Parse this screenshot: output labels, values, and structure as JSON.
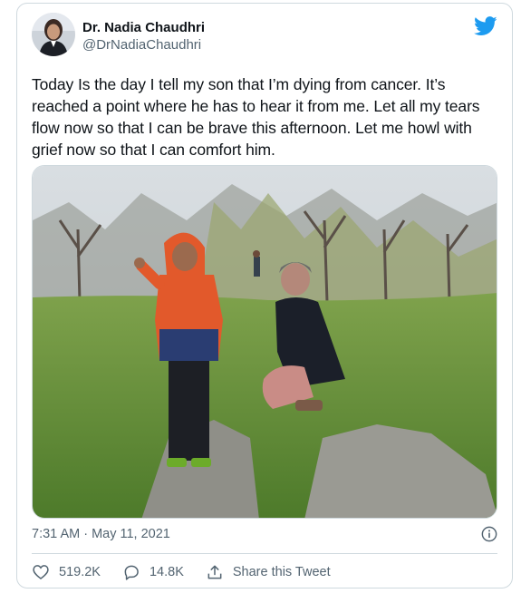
{
  "user": {
    "display_name": "Dr. Nadia Chaudhri",
    "handle": "@DrNadiaChaudhri"
  },
  "tweet": {
    "text": "Today Is the day I tell my son that I’m dying from cancer. It’s reached a point where he has to hear it from me. Let all my tears flow now so that I can be brave this afternoon. Let me howl with grief now so that I can comfort him.",
    "timestamp": "7:31 AM · May 11, 2021"
  },
  "actions": {
    "likes": "519.2K",
    "replies": "14.8K",
    "share_label": "Share this Tweet"
  },
  "icons": {
    "brand": "twitter-bird-icon",
    "info": "info-icon",
    "like": "heart-icon",
    "reply": "reply-icon",
    "share": "share-icon"
  },
  "colors": {
    "brand": "#1d9bf0",
    "text": "#0f1419",
    "secondary": "#536471",
    "border": "#cfd9de"
  }
}
